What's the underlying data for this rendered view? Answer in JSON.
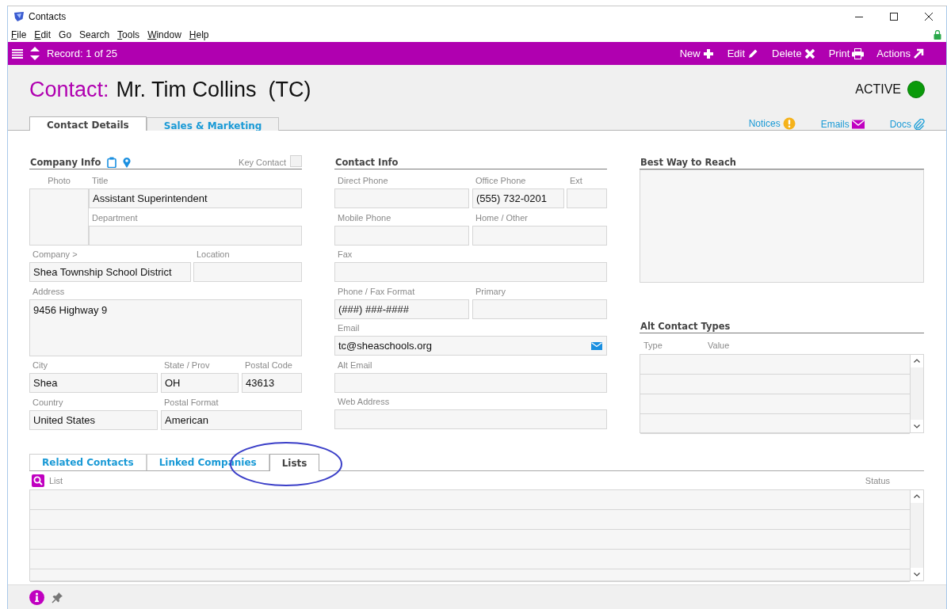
{
  "window": {
    "title": "Contacts"
  },
  "menu": [
    {
      "label": "File",
      "underlined": true
    },
    {
      "label": "Edit",
      "underlined": true
    },
    {
      "label": "Go",
      "underlined": false
    },
    {
      "label": "Search",
      "underlined": false
    },
    {
      "label": "Tools",
      "underlined": true
    },
    {
      "label": "Window",
      "underlined": true
    },
    {
      "label": "Help",
      "underlined": true
    }
  ],
  "toolbar": {
    "record": "Record: 1 of 25",
    "actions": [
      {
        "label": "New",
        "kind": "new"
      },
      {
        "label": "Edit",
        "kind": "edit"
      },
      {
        "label": "Delete",
        "kind": "delete"
      },
      {
        "label": "Print",
        "kind": "print"
      },
      {
        "label": "Actions",
        "kind": "actions"
      }
    ]
  },
  "header": {
    "prefix": "Contact:",
    "name": "Mr. Tim Collins  (TC)",
    "status": "ACTIVE",
    "active": true
  },
  "tabs": [
    {
      "label": "Contact Details",
      "selected": true
    },
    {
      "label": "Sales & Marketing",
      "selected": false
    }
  ],
  "links": [
    {
      "label": "Notices",
      "kind": "notices"
    },
    {
      "label": "Emails",
      "kind": "emails"
    },
    {
      "label": "Docs",
      "kind": "docs"
    }
  ],
  "company_info": {
    "title": "Company Info",
    "key_contact": {
      "label": "Key Contact",
      "checked": false
    },
    "fields": [
      {
        "label": "Photo",
        "kind": "photo"
      },
      {
        "label": "Title",
        "kind": "text",
        "value": "Assistant Superintendent"
      },
      {
        "label": "Department",
        "kind": "text"
      },
      {
        "label": "Company >",
        "kind": "text",
        "value": "Shea Township School District"
      },
      {
        "label": "Location",
        "kind": "text"
      },
      {
        "label": "Address",
        "kind": "area",
        "value": "9456 Highway 9"
      },
      {
        "label": "City",
        "kind": "text",
        "value": "Shea"
      },
      {
        "label": "State / Prov",
        "kind": "text",
        "value": "OH"
      },
      {
        "label": "Postal Code",
        "kind": "text",
        "value": "43613"
      },
      {
        "label": "Country",
        "kind": "text",
        "value": "United States"
      },
      {
        "label": "Postal Format",
        "kind": "text",
        "value": "American"
      }
    ]
  },
  "contact_info": {
    "title": "Contact Info",
    "fields": [
      {
        "label": "Direct Phone",
        "kind": "text"
      },
      {
        "label": "Office Phone",
        "kind": "text",
        "value": "(555) 732-0201"
      },
      {
        "label": "Ext",
        "kind": "text"
      },
      {
        "label": "Mobile Phone",
        "kind": "text"
      },
      {
        "label": "Home / Other",
        "kind": "text"
      },
      {
        "label": "Fax",
        "kind": "text"
      },
      {
        "label": "Phone / Fax Format",
        "kind": "text",
        "value": "(###) ###-####"
      },
      {
        "label": "Primary",
        "kind": "text"
      },
      {
        "label": "Email",
        "kind": "email",
        "value": "tc@sheaschools.org"
      },
      {
        "label": "Alt Email",
        "kind": "text"
      },
      {
        "label": "Web Address",
        "kind": "text"
      }
    ]
  },
  "best_way": {
    "title": "Best Way to Reach"
  },
  "alt_contact_types": {
    "title": "Alt Contact Types",
    "columns": [
      "Type",
      "Value"
    ]
  },
  "bottom_tabs": [
    {
      "label": "Related Contacts",
      "selected": false
    },
    {
      "label": "Linked Companies",
      "selected": false
    },
    {
      "label": "Lists",
      "selected": true
    }
  ],
  "lists_table": {
    "columns": [
      "List",
      "Status"
    ]
  },
  "annotation": {
    "kind": "ellipse"
  }
}
